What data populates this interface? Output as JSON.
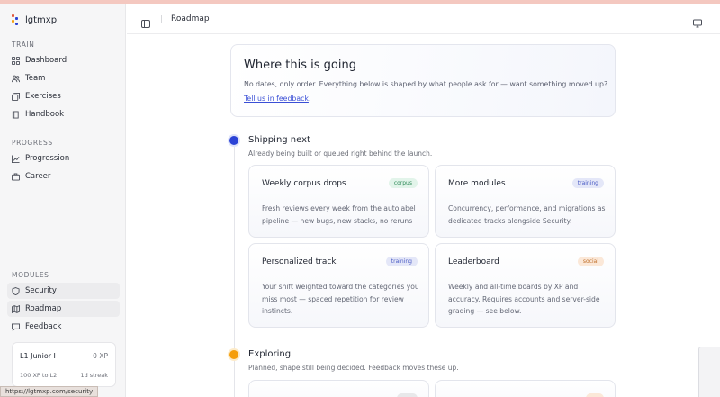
{
  "brand": {
    "name": "lgtmxp",
    "colors": [
      "#e0563a",
      "#2b43d6",
      "#f59e0b",
      "#2b43d6"
    ]
  },
  "sidebar": {
    "sections": [
      {
        "label": "TRAIN",
        "items": [
          {
            "label": "Dashboard",
            "icon": "grid-icon"
          },
          {
            "label": "Team",
            "icon": "users-icon"
          },
          {
            "label": "Exercises",
            "icon": "layers-icon"
          },
          {
            "label": "Handbook",
            "icon": "book-icon"
          }
        ]
      },
      {
        "label": "PROGRESS",
        "items": [
          {
            "label": "Progression",
            "icon": "chart-icon"
          },
          {
            "label": "Career",
            "icon": "briefcase-icon"
          }
        ]
      },
      {
        "label": "MODULES",
        "items": [
          {
            "label": "Security",
            "icon": "shield-icon"
          },
          {
            "label": "Roadmap",
            "icon": "map-icon"
          },
          {
            "label": "Feedback",
            "icon": "message-icon"
          }
        ]
      }
    ],
    "level": {
      "title": "L1 Junior I",
      "xp": "0 XP",
      "next": "100 XP to L2",
      "streak": "1d streak"
    }
  },
  "status_url": "https://lgtmxp.com/security",
  "header": {
    "title": "Roadmap"
  },
  "hero": {
    "title": "Where this is going",
    "description": "No dates, only order. Everything below is shaped by what people ask for — want something moved up?",
    "link": "Tell us in feedback",
    "link_suffix": "."
  },
  "phases": [
    {
      "title": "Shipping next",
      "subtitle": "Already being built or queued right behind the launch.",
      "cards": [
        {
          "title": "Weekly corpus drops",
          "badge": "corpus",
          "description": "Fresh reviews every week from the autolabel pipeline — new bugs, new stacks, no reruns"
        },
        {
          "title": "More modules",
          "badge": "training",
          "description": "Concurrency, performance, and migrations as dedicated tracks alongside Security."
        },
        {
          "title": "Personalized track",
          "badge": "training",
          "description": "Your shift weighted toward the categories you miss most — spaced repetition for review instincts."
        },
        {
          "title": "Leaderboard",
          "badge": "social",
          "description": "Weekly and all-time boards by XP and accuracy. Requires accounts and server-side grading — see below."
        }
      ]
    },
    {
      "title": "Exploring",
      "subtitle": "Planned, shape still being decided. Feedback moves these up.",
      "cards": []
    }
  ]
}
